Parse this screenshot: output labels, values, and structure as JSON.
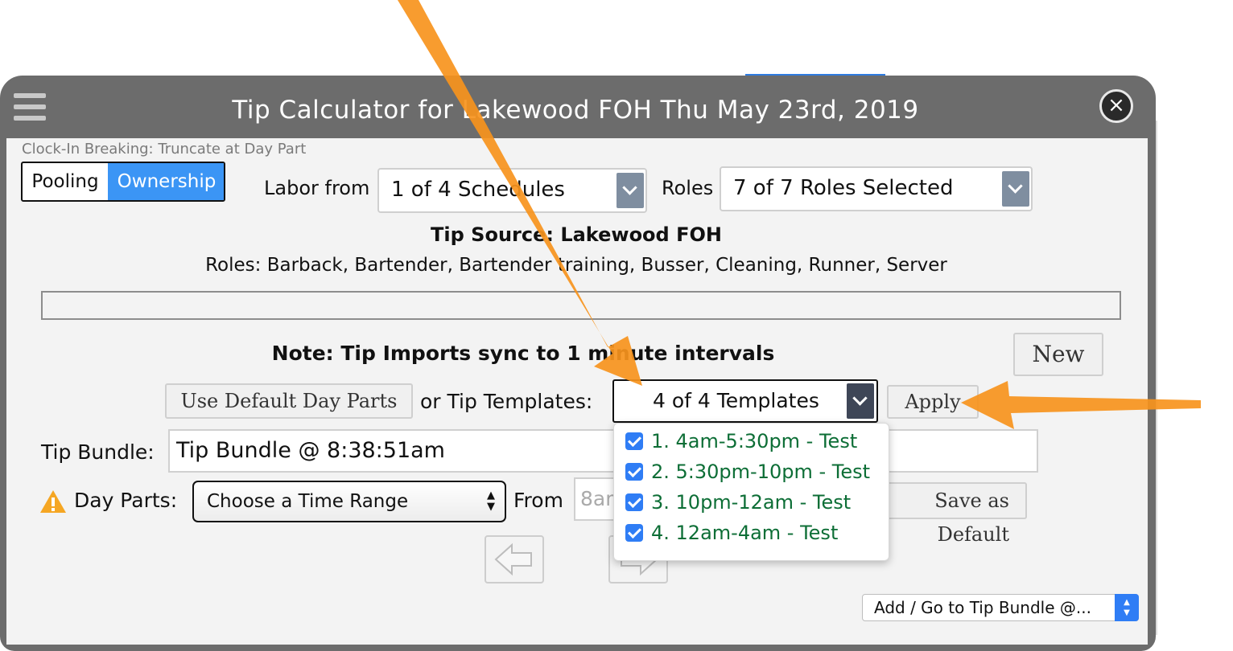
{
  "modal": {
    "title": "Tip Calculator for Lakewood FOH Thu May 23rd, 2019",
    "close_symbol": "×"
  },
  "clock_in_note": "Clock-In Breaking: Truncate at Day Part",
  "mode_toggle": {
    "pooling": "Pooling",
    "ownership": "Ownership",
    "active": "Ownership"
  },
  "labor": {
    "label": "Labor from",
    "value": "1 of 4 Schedules"
  },
  "roles": {
    "label": "Roles",
    "value": "7 of 7 Roles Selected"
  },
  "tip_source": "Tip Source: Lakewood FOH",
  "roles_list": "Roles: Barback, Bartender, Bartender training, Busser, Cleaning, Runner, Server",
  "note": "Note: Tip Imports sync to 1 minute intervals",
  "new_button": "New",
  "default_day_parts_button": "Use Default Day Parts",
  "tip_templates": {
    "label": "or Tip Templates:",
    "value": "4 of 4 Templates",
    "options": [
      {
        "label": "1. 4am-5:30pm - Test",
        "checked": true
      },
      {
        "label": "2. 5:30pm-10pm - Test",
        "checked": true
      },
      {
        "label": "3. 10pm-12am - Test",
        "checked": true
      },
      {
        "label": "4. 12am-4am - Test",
        "checked": true
      }
    ]
  },
  "apply_button": "Apply",
  "tip_bundle": {
    "label": "Tip Bundle:",
    "value": "Tip Bundle @ 8:38:51am"
  },
  "day_parts": {
    "label": "Day Parts:",
    "value": "Choose a Time Range",
    "from_label": "From",
    "from_value": "8am"
  },
  "save_default_button": "Save as Default",
  "bundle_select": {
    "value": "Add / Go to Tip Bundle @..."
  },
  "colors": {
    "header_gray": "#6c6c6c",
    "ownership_blue": "#3b95f5",
    "option_green": "#0d6e36",
    "arrow_orange": "#f7941d",
    "warning_yellow": "#f5a623"
  }
}
